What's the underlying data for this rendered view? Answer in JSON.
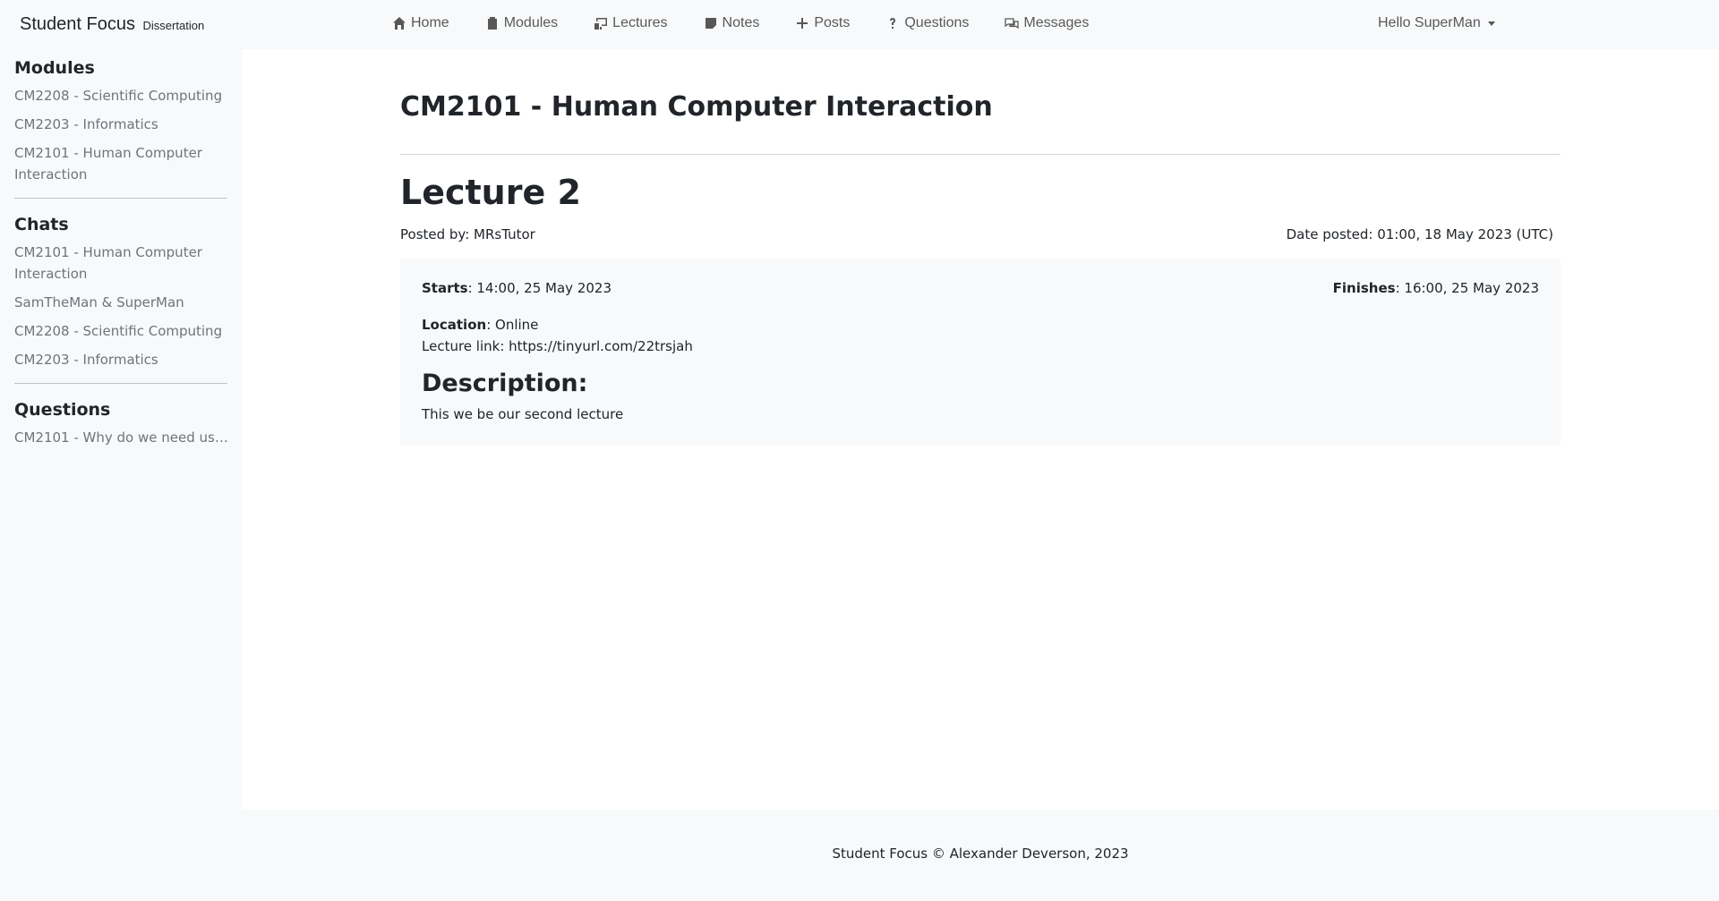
{
  "brand": {
    "name": "Student Focus",
    "sub": "Dissertation"
  },
  "nav": {
    "items": [
      {
        "label": "Home",
        "icon": "home-icon"
      },
      {
        "label": "Modules",
        "icon": "clipboard-icon"
      },
      {
        "label": "Lectures",
        "icon": "easel-icon"
      },
      {
        "label": "Notes",
        "icon": "sticky-note-icon"
      },
      {
        "label": "Posts",
        "icon": "plus-icon"
      },
      {
        "label": "Questions",
        "icon": "question-icon"
      },
      {
        "label": "Messages",
        "icon": "chat-icon"
      }
    ],
    "user_label": "Hello SuperMan"
  },
  "sidebar": {
    "modules": {
      "heading": "Modules",
      "items": [
        "CM2208 - Scientific Computing",
        "CM2203 - Informatics",
        "CM2101 - Human Computer Interaction"
      ]
    },
    "chats": {
      "heading": "Chats",
      "items": [
        "CM2101 - Human Computer Interaction",
        "SamTheMan & SuperMan",
        "CM2208 - Scientific Computing",
        "CM2203 - Informatics"
      ]
    },
    "questions": {
      "heading": "Questions",
      "items": [
        "CM2101 - Why do we need use..."
      ]
    }
  },
  "main": {
    "module_title": "CM2101 - Human Computer Interaction",
    "lecture_title": "Lecture 2",
    "posted_by": "Posted by: MRsTutor",
    "date_posted": "Date posted: 01:00, 18 May 2023 (UTC)",
    "details": {
      "starts_label": "Starts",
      "starts_value": ": 14:00, 25 May 2023",
      "finishes_label": "Finishes",
      "finishes_value": ": 16:00, 25 May 2023",
      "location_label": "Location",
      "location_value": ": Online",
      "link_text": "Lecture link: https://tinyurl.com/22trsjah",
      "description_heading": "Description:",
      "description_text": "This we be our second lecture"
    }
  },
  "footer": {
    "text": "Student Focus © Alexander Deverson, 2023"
  }
}
